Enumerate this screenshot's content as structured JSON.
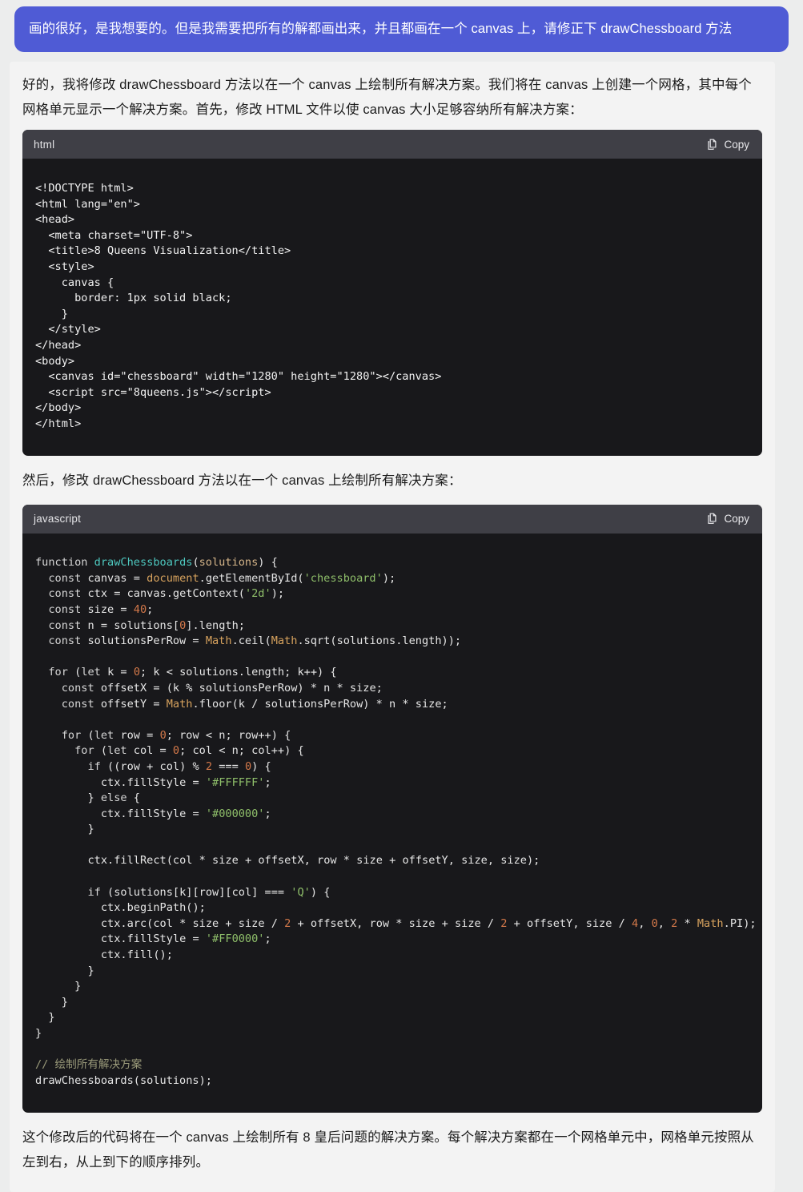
{
  "user_message": {
    "text": "画的很好，是我想要的。但是我需要把所有的解都画出来，并且都画在一个 canvas 上，请修正下 drawChessboard 方法"
  },
  "assistant": {
    "intro_paragraph": "好的，我将修改 drawChessboard 方法以在一个 canvas 上绘制所有解决方案。我们将在 canvas 上创建一个网格，其中每个网格单元显示一个解决方案。首先，修改 HTML 文件以使 canvas 大小足够容纳所有解决方案：",
    "middle_paragraph": "然后，修改 drawChessboard 方法以在一个 canvas 上绘制所有解决方案：",
    "closing_paragraph": "这个修改后的代码将在一个 canvas 上绘制所有 8 皇后问题的解决方案。每个解决方案都在一个网格单元中，网格单元按照从左到右，从上到下的顺序排列。"
  },
  "code_blocks": [
    {
      "language": "html",
      "copy_label": "Copy",
      "copy_icon": "copy-icon",
      "code": "<!DOCTYPE html>\n<html lang=\"en\">\n<head>\n  <meta charset=\"UTF-8\">\n  <title>8 Queens Visualization</title>\n  <style>\n    canvas {\n      border: 1px solid black;\n    }\n  </style>\n</head>\n<body>\n  <canvas id=\"chessboard\" width=\"1280\" height=\"1280\"></canvas>\n  <script src=\"8queens.js\"></script>\n</body>\n</html>"
    },
    {
      "language": "javascript",
      "copy_label": "Copy",
      "copy_icon": "copy-icon",
      "code": "function drawChessboards(solutions) {\n  const canvas = document.getElementById('chessboard');\n  const ctx = canvas.getContext('2d');\n  const size = 40;\n  const n = solutions[0].length;\n  const solutionsPerRow = Math.ceil(Math.sqrt(solutions.length));\n\n  for (let k = 0; k < solutions.length; k++) {\n    const offsetX = (k % solutionsPerRow) * n * size;\n    const offsetY = Math.floor(k / solutionsPerRow) * n * size;\n\n    for (let row = 0; row < n; row++) {\n      for (let col = 0; col < n; col++) {\n        if ((row + col) % 2 === 0) {\n          ctx.fillStyle = '#FFFFFF';\n        } else {\n          ctx.fillStyle = '#000000';\n        }\n\n        ctx.fillRect(col * size + offsetX, row * size + offsetY, size, size);\n\n        if (solutions[k][row][col] === 'Q') {\n          ctx.beginPath();\n          ctx.arc(col * size + size / 2 + offsetX, row * size + size / 2 + offsetY, size / 4, 0, 2 * Math.PI);\n          ctx.fillStyle = '#FF0000';\n          ctx.fill();\n        }\n      }\n    }\n  }\n}\n\n// 绘制所有解决方案\ndrawChessboards(solutions);"
    }
  ],
  "colors": {
    "user_bubble": "#4f5bd5",
    "code_header": "#3f3f46",
    "code_background": "#18181b",
    "page_background": "#eceded",
    "assistant_panel": "#f3f3f3",
    "token_function": "#4ec9c0",
    "token_param": "#d5b589",
    "token_string": "#8fbf6a",
    "token_number": "#d4794a",
    "token_object": "#d8a35e",
    "token_comment": "#9a9a7a"
  }
}
